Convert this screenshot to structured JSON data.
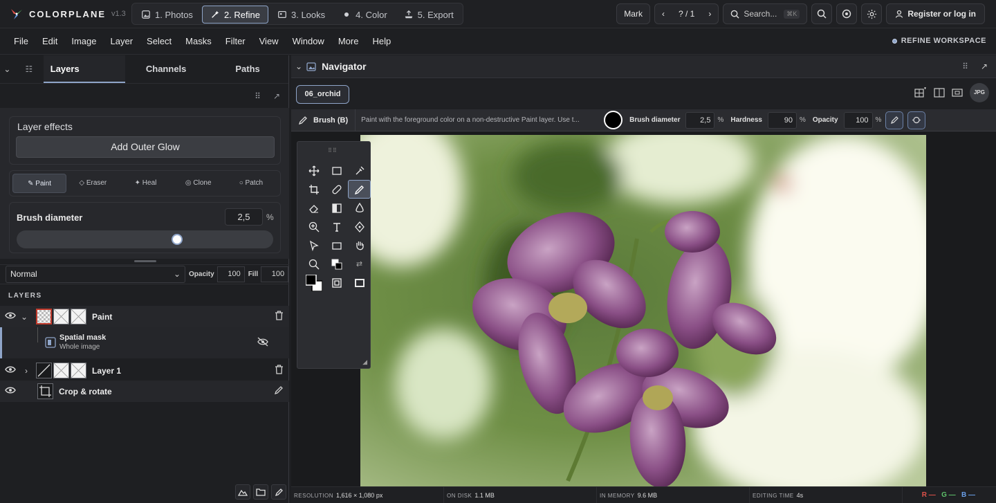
{
  "app": {
    "name": "COLORPLANE",
    "version": "v1.3"
  },
  "steps": [
    {
      "label": "1. Photos",
      "icon": "photos-icon"
    },
    {
      "label": "2. Refine",
      "icon": "refine-wand-icon",
      "active": true
    },
    {
      "label": "3. Looks",
      "icon": "looks-icon"
    },
    {
      "label": "4. Color",
      "icon": "color-dot-icon"
    },
    {
      "label": "5. Export",
      "icon": "export-icon"
    }
  ],
  "topbar": {
    "mark_label": "Mark",
    "pager": "? / 1",
    "search_placeholder": "Search...",
    "search_kbd": "⌘K",
    "register_label": "Register or log in"
  },
  "menu": [
    "File",
    "Edit",
    "Image",
    "Layer",
    "Select",
    "Masks",
    "Filter",
    "View",
    "Window",
    "More",
    "Help"
  ],
  "workspace_label": "REFINE WORKSPACE",
  "left": {
    "tabs": [
      "Layers",
      "Channels",
      "Paths"
    ],
    "effects_title": "Layer effects",
    "effects_button": "Add Outer Glow",
    "tool_tabs": [
      {
        "label": "Paint",
        "glyph": "✎",
        "active": true
      },
      {
        "label": "Eraser",
        "glyph": "◇"
      },
      {
        "label": "Heal",
        "glyph": "✦"
      },
      {
        "label": "Clone",
        "glyph": "◎"
      },
      {
        "label": "Patch",
        "glyph": "○"
      }
    ],
    "brush_label": "Brush diameter",
    "brush_value": "2,5",
    "brush_unit": "%",
    "brush_level": 0.63,
    "blend_mode": "Normal",
    "opacity_label": "Opacity",
    "opacity_value": "100",
    "fill_label": "Fill",
    "fill_value": "100",
    "layers_heading": "LAYERS",
    "layers": [
      {
        "name": "Paint"
      },
      {
        "name": "Layer 1"
      },
      {
        "name": "Crop & rotate"
      }
    ],
    "mask": {
      "title": "Spatial mask",
      "subtitle": "Whole image"
    }
  },
  "navigator": {
    "title": "Navigator",
    "file_chip": "06_orchid",
    "badge": "JPG"
  },
  "options": {
    "tool_name": "Brush (B)",
    "description": "Paint with the foreground color on a non-destructive Paint layer. Use t...",
    "diameter_label": "Brush diameter",
    "diameter_value": "2,5",
    "hardness_label": "Hardness",
    "hardness_value": "90",
    "opacity_label": "Opacity",
    "opacity_value": "100",
    "unit": "%"
  },
  "status": {
    "resolution_label": "RESOLUTION",
    "resolution_value": "1,616 × 1,080 px",
    "disk_label": "ON DISK",
    "disk_value": "1.1 MB",
    "memory_label": "IN MEMORY",
    "memory_value": "9.6 MB",
    "time_label": "EDITING TIME",
    "time_value": "4s",
    "r": "R —",
    "g": "G —",
    "b": "B —"
  },
  "colors": {
    "accent": "#8fa5c9",
    "r": "#e0524a",
    "g": "#5dc26a",
    "b": "#6a9fe8"
  }
}
